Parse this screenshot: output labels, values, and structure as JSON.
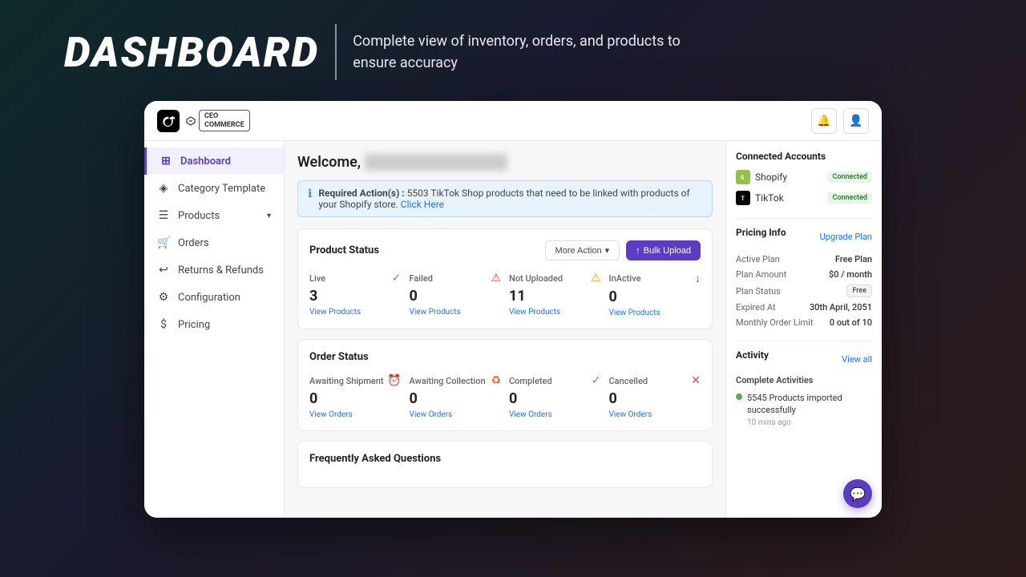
{
  "hero": {
    "title": "DASHBOARD",
    "subtitle": "Complete view of inventory, orders, and products to ensure accuracy",
    "divider": true
  },
  "topbar": {
    "tiktok_label": "T",
    "ceocommerce_line1": "CEO",
    "ceocommerce_line2": "COMMERCE",
    "bell_icon": "🔔",
    "user_icon": "👤"
  },
  "sidebar": {
    "items": [
      {
        "label": "Dashboard",
        "icon": "⊞",
        "active": true
      },
      {
        "label": "Category Template",
        "icon": "◈",
        "active": false
      },
      {
        "label": "Products",
        "icon": "☰",
        "active": false,
        "has_chevron": true
      },
      {
        "label": "Orders",
        "icon": "🛒",
        "active": false
      },
      {
        "label": "Returns & Refunds",
        "icon": "↩",
        "active": false
      },
      {
        "label": "Configuration",
        "icon": "⚙",
        "active": false
      },
      {
        "label": "Pricing",
        "icon": "$",
        "active": false
      }
    ]
  },
  "content": {
    "welcome": "Welcome,",
    "welcome_blurred": "username blurred for privacy demo",
    "alert": {
      "icon": "ℹ",
      "label": "Required Action(s) :",
      "message": "5503 TikTok Shop products that need to be linked with products of your Shopify store.",
      "link_text": "Click Here"
    },
    "product_status": {
      "title": "Product Status",
      "more_action_label": "More Action",
      "bulk_upload_label": "Bulk Upload",
      "items": [
        {
          "label": "Live",
          "icon": "✓",
          "icon_color": "#4caf50",
          "count": "3",
          "link": "View Products"
        },
        {
          "label": "Failed",
          "icon": "⚠",
          "icon_color": "#f44336",
          "count": "0",
          "link": "View Products"
        },
        {
          "label": "Not Uploaded",
          "icon": "⚠",
          "icon_color": "#ff9800",
          "count": "11",
          "link": "View Products"
        },
        {
          "label": "InActive",
          "icon": "↓",
          "icon_color": "#9c27b0",
          "count": "0",
          "link": "View Products"
        }
      ]
    },
    "order_status": {
      "title": "Order Status",
      "items": [
        {
          "label": "Awaiting Shipment",
          "icon": "⏰",
          "icon_color": "#ff9800",
          "count": "0",
          "link": "View Orders"
        },
        {
          "label": "Awaiting Collection",
          "icon": "♻",
          "icon_color": "#ff5722",
          "count": "0",
          "link": "View Orders"
        },
        {
          "label": "Completed",
          "icon": "✓",
          "icon_color": "#4caf50",
          "count": "0",
          "link": "View Orders"
        },
        {
          "label": "Cancelled",
          "icon": "✕",
          "icon_color": "#f44336",
          "count": "0",
          "link": "View Orders"
        }
      ]
    },
    "faq": {
      "title": "Frequently Asked Questions"
    }
  },
  "right_panel": {
    "connected_accounts": {
      "title": "Connected Accounts",
      "accounts": [
        {
          "name": "Shopify",
          "logo": "S",
          "logo_bg": "#96bf48",
          "status": "Connected"
        },
        {
          "name": "TikTok",
          "logo": "T",
          "logo_bg": "#000000",
          "status": "Connected"
        }
      ]
    },
    "pricing_info": {
      "title": "Pricing Info",
      "upgrade_label": "Upgrade Plan",
      "rows": [
        {
          "label": "Active Plan",
          "value": "Free Plan"
        },
        {
          "label": "Plan Amount",
          "value": "$0 / month"
        },
        {
          "label": "Plan Status",
          "value": "Free",
          "is_badge": true
        },
        {
          "label": "Expired At",
          "value": "30th April, 2051"
        },
        {
          "label": "Monthly Order Limit",
          "value": "0 out of 10"
        }
      ]
    },
    "activity": {
      "title": "Activity",
      "view_all_label": "View all",
      "complete_activities_label": "Complete Activities",
      "items": [
        {
          "text": "5545 Products imported successfully",
          "time": "10 mins ago",
          "color": "#4caf50"
        }
      ]
    }
  },
  "chat": {
    "icon": "💬"
  }
}
